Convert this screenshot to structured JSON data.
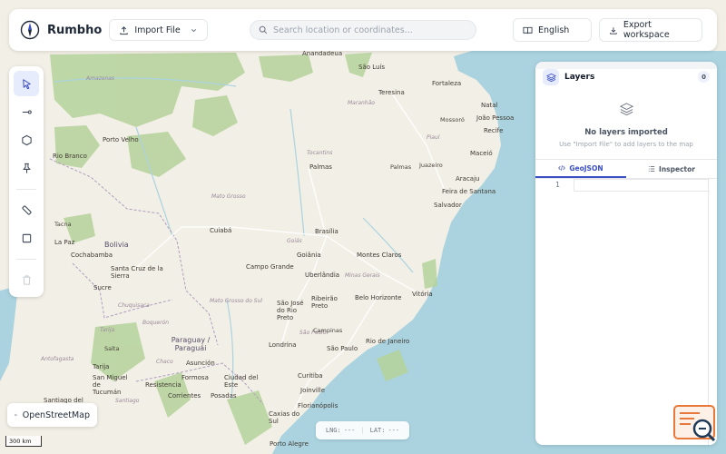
{
  "app": {
    "name": "Rumbho"
  },
  "toolbar": {
    "import_label": "Import File",
    "search_placeholder": "Search location or coordinates...",
    "language_label": "English",
    "export_label": "Export workspace"
  },
  "tools": [
    {
      "name": "select-tool",
      "icon": "cursor-arrow-icon",
      "active": true
    },
    {
      "name": "line-tool",
      "icon": "polyline-icon"
    },
    {
      "name": "polygon-tool",
      "icon": "hexagon-icon"
    },
    {
      "name": "marker-tool",
      "icon": "pin-icon"
    },
    {
      "name": "measure-tool",
      "icon": "ruler-icon"
    },
    {
      "name": "rectangle-tool",
      "icon": "square-icon"
    },
    {
      "name": "delete-tool",
      "icon": "trash-icon",
      "disabled": true
    }
  ],
  "panel": {
    "title": "Layers",
    "count": "0",
    "empty_title": "No layers imported",
    "empty_subtitle": "Use \"Import File\" to add layers to the map",
    "tabs": [
      {
        "label": "GeoJSON",
        "active": true,
        "icon": "code-icon"
      },
      {
        "label": "Inspector",
        "icon": "list-icon"
      }
    ],
    "editor_line": "1"
  },
  "basemap": {
    "label": "OpenStreetMap"
  },
  "coordinates": {
    "lng_label": "LNG:",
    "lng_value": "---",
    "lat_label": "LAT:",
    "lat_value": "---"
  },
  "scale": {
    "label": "300 km"
  },
  "colors": {
    "accent": "#3b4fc4",
    "map_base": "#f2efe6",
    "forest": "#b5d29a",
    "water": "#aad3df"
  },
  "map": {
    "countries": [
      "Bolivia",
      "Paraguay / Paraguái"
    ],
    "states": [
      "Amazonas",
      "Maranhão",
      "Tocantins",
      "Mato Grosso",
      "Goiás",
      "Minas Gerais",
      "Mato Grosso do Sul",
      "São Paulo",
      "Piauí",
      "Chaco",
      "Antofagasta",
      "Chuquisaca",
      "Tarija",
      "Santiago",
      "Boquerón"
    ],
    "cities": [
      "Anandadeua",
      "São Luís",
      "Teresina",
      "Fortaleza",
      "Natal",
      "João Pessoa",
      "Recife",
      "Maceió",
      "Aracaju",
      "Feira de Santana",
      "Salvador",
      "Porto Velho",
      "Rio Branco",
      "Palmas",
      "Brasília",
      "Cuiabá",
      "Goiânia",
      "Uberlândia",
      "Montes Claros",
      "La Paz",
      "Cochabamba",
      "Santa Cruz de la Sierra",
      "Sucre",
      "Tarija",
      "Campo Grande",
      "São José do Rio Preto",
      "Ribeirão Preto",
      "Belo Horizonte",
      "Vitória",
      "Londrina",
      "São Paulo",
      "Rio de Janeiro",
      "Asunción",
      "Formosa",
      "Resistencia",
      "Corrientes",
      "Posadas",
      "Ciudad del Este",
      "Curitiba",
      "Joinville",
      "Florianópolis",
      "Caxias do Sul",
      "Porto Alegre",
      "San Miguel de Tucumán",
      "Santiago del Estero",
      "Salta",
      "Tacna",
      "Mossoró",
      "Palmas",
      "Juazeiro",
      "Campinas"
    ]
  }
}
